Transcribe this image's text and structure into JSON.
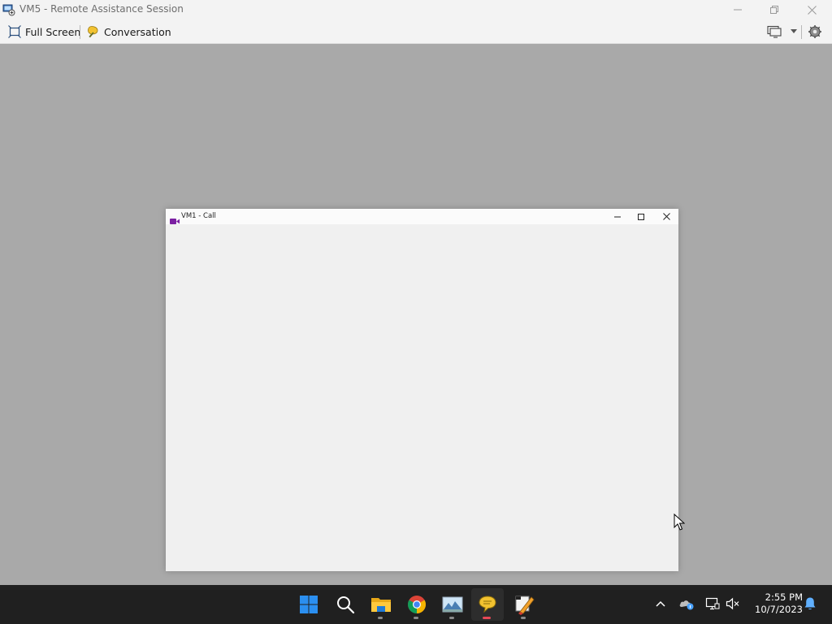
{
  "window": {
    "title": "VM5 - Remote Assistance Session"
  },
  "toolbar": {
    "full_screen_label": "Full Screen",
    "conversation_label": "Conversation"
  },
  "call_window": {
    "title": "VM1 - Call"
  },
  "clock": {
    "time": "2:55 PM",
    "date": "10/7/2023"
  },
  "taskbar": {
    "apps": [
      "start-icon",
      "search-icon",
      "file-explorer-icon",
      "chrome-icon",
      "photos-icon",
      "chat-icon",
      "paint-icon"
    ]
  },
  "colors": {
    "desktop": "#a9a9a9",
    "taskbar": "#202020",
    "accent_blue": "#0078d4",
    "call_icon": "#7b1fa2"
  }
}
